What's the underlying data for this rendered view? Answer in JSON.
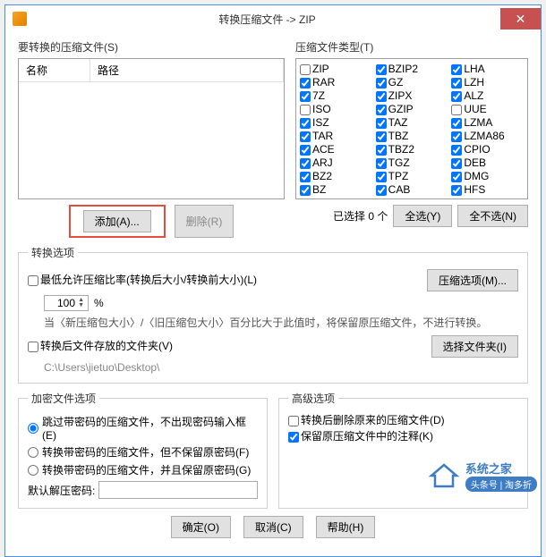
{
  "title": "转换压缩文件 -> ZIP",
  "left": {
    "label": "要转换的压缩文件(S)",
    "cols": {
      "name": "名称",
      "path": "路径"
    },
    "add": "添加(A)...",
    "del": "删除(R)"
  },
  "right": {
    "label": "压缩文件类型(T)",
    "sel": "已选择 0 个",
    "all": "全选(Y)",
    "none": "全不选(N)",
    "types": [
      {
        "n": "ZIP",
        "c": false
      },
      {
        "n": "BZIP2",
        "c": true
      },
      {
        "n": "LHA",
        "c": true
      },
      {
        "n": "RAR",
        "c": true
      },
      {
        "n": "GZ",
        "c": true
      },
      {
        "n": "LZH",
        "c": true
      },
      {
        "n": "7Z",
        "c": true
      },
      {
        "n": "ZIPX",
        "c": true
      },
      {
        "n": "ALZ",
        "c": true
      },
      {
        "n": "ISO",
        "c": false
      },
      {
        "n": "GZIP",
        "c": true
      },
      {
        "n": "UUE",
        "c": false
      },
      {
        "n": "ISZ",
        "c": true
      },
      {
        "n": "TAZ",
        "c": true
      },
      {
        "n": "LZMA",
        "c": true
      },
      {
        "n": "TAR",
        "c": true
      },
      {
        "n": "TBZ",
        "c": true
      },
      {
        "n": "LZMA86",
        "c": true
      },
      {
        "n": "ACE",
        "c": true
      },
      {
        "n": "TBZ2",
        "c": true
      },
      {
        "n": "CPIO",
        "c": true
      },
      {
        "n": "ARJ",
        "c": true
      },
      {
        "n": "TGZ",
        "c": true
      },
      {
        "n": "DEB",
        "c": true
      },
      {
        "n": "BZ2",
        "c": true
      },
      {
        "n": "TPZ",
        "c": true
      },
      {
        "n": "DMG",
        "c": true
      },
      {
        "n": "BZ",
        "c": true
      },
      {
        "n": "CAB",
        "c": true
      },
      {
        "n": "HFS",
        "c": true
      }
    ]
  },
  "opts": {
    "legend": "转换选项",
    "ratio": "最低允许压缩比率(转换后大小/转换前大小)(L)",
    "ratio_val": "100",
    "pct": "%",
    "ratio_hint": "当〈新压缩包大小〉/〈旧压缩包大小〉百分比大于此值时，将保留原压缩文件，不进行转换。",
    "folder": "转换后文件存放的文件夹(V)",
    "folder_path": "C:\\Users\\jietuo\\Desktop\\",
    "compress_opt": "压缩选项(M)...",
    "select_folder": "选择文件夹(I)"
  },
  "enc": {
    "legend": "加密文件选项",
    "r1": "跳过带密码的压缩文件，不出现密码输入框(E)",
    "r2": "转换带密码的压缩文件，但不保留原密码(F)",
    "r3": "转换带密码的压缩文件，并且保留原密码(G)",
    "pwlabel": "默认解压密码:"
  },
  "adv": {
    "legend": "高级选项",
    "c1": "转换后删除原来的压缩文件(D)",
    "c2": "保留原压缩文件中的注释(K)"
  },
  "btns": {
    "ok": "确定(O)",
    "cancel": "取消(C)",
    "help": "帮助(H)"
  },
  "wm": {
    "brand": "系统之家",
    "sub": "头条号 | 淘多折"
  }
}
